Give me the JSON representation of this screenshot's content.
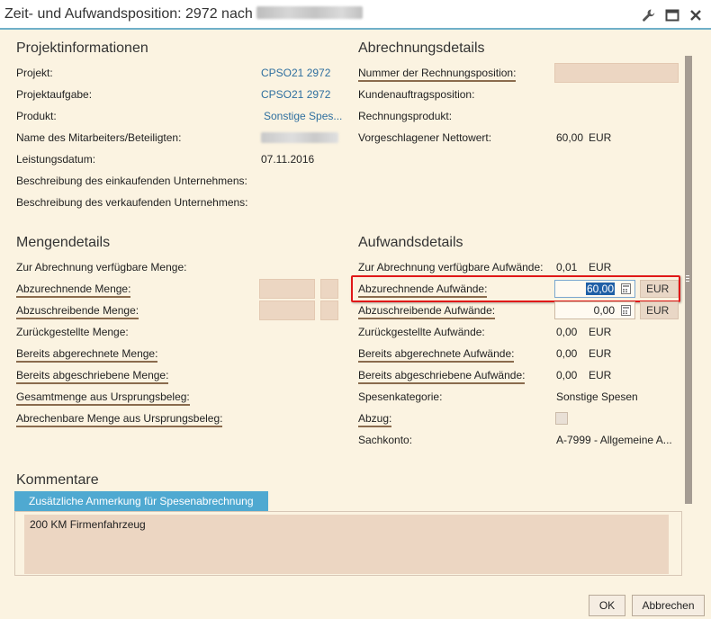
{
  "window": {
    "title": "Zeit- und Aufwandsposition: 2972 nach"
  },
  "projekt": {
    "heading": "Projektinformationen",
    "labels": {
      "projekt": "Projekt:",
      "aufgabe": "Projektaufgabe:",
      "produkt": "Produkt:",
      "mitarbeiter": "Name des Mitarbeiters/Beteiligten:",
      "datum": "Leistungsdatum:",
      "einkauf": "Beschreibung des einkaufenden Unternehmens:",
      "verkauf": "Beschreibung des verkaufenden Unternehmens:"
    },
    "values": {
      "projekt": "CPSO21 2972",
      "aufgabe": "CPSO21 2972",
      "produkt": "Sonstige Spes...",
      "datum": "07.11.2016"
    }
  },
  "abrechnung": {
    "heading": "Abrechnungsdetails",
    "labels": {
      "nummer": "Nummer der Rechnungsposition:",
      "kunde": "Kundenauftragsposition:",
      "rprodukt": "Rechnungsprodukt:",
      "netto": "Vorgeschlagener Nettowert:"
    },
    "values": {
      "netto": "60,00",
      "netto_cur": "EUR"
    }
  },
  "menge": {
    "heading": "Mengendetails",
    "labels": {
      "verfuegbar": "Zur Abrechnung verfügbare Menge:",
      "abzurechnen": "Abzurechnende Menge:",
      "abzuschreiben": "Abzuschreibende Menge:",
      "zurueck": "Zurückgestellte Menge:",
      "abgerechnet": "Bereits abgerechnete Menge:",
      "abgeschrieben": "Bereits abgeschriebene Menge:",
      "gesamt": "Gesamtmenge aus Ursprungsbeleg:",
      "abrechenbar": "Abrechenbare Menge aus Ursprungsbeleg:"
    }
  },
  "aufwand": {
    "heading": "Aufwandsdetails",
    "labels": {
      "verfuegbar": "Zur Abrechnung verfügbare Aufwände:",
      "abzurechnen": "Abzurechnende Aufwände:",
      "abzuschreiben": "Abzuschreibende Aufwände:",
      "zurueck": "Zurückgestellte Aufwände:",
      "abgerechnet": "Bereits abgerechnete Aufwände:",
      "abgeschrieben": "Bereits abgeschriebene Aufwände:",
      "kategorie": "Spesenkategorie:",
      "abzug": "Abzug:",
      "sachkonto": "Sachkonto:"
    },
    "values": {
      "verfuegbar": "0,01",
      "verfuegbar_cur": "EUR",
      "abzurechnen": "60,00",
      "abzurechnen_cur": "EUR",
      "abzuschreiben": "0,00",
      "abzuschreiben_cur": "EUR",
      "zurueck": "0,00",
      "zurueck_cur": "EUR",
      "abgerechnet": "0,00",
      "abgerechnet_cur": "EUR",
      "abgeschrieben": "0,00",
      "abgeschrieben_cur": "EUR",
      "kategorie": "Sonstige Spesen",
      "sachkonto": "A-7999 - Allgemeine A..."
    }
  },
  "kommentare": {
    "heading": "Kommentare",
    "tab": "Zusätzliche Anmerkung für Spesenabrechnung",
    "text": "200 KM Firmenfahrzeug"
  },
  "buttons": {
    "ok": "OK",
    "cancel": "Abbrechen"
  },
  "colors": {
    "accent": "#4fa9d1",
    "highlight": "#e01818",
    "link": "#2f6f9f",
    "background": "#fbf3e1"
  }
}
